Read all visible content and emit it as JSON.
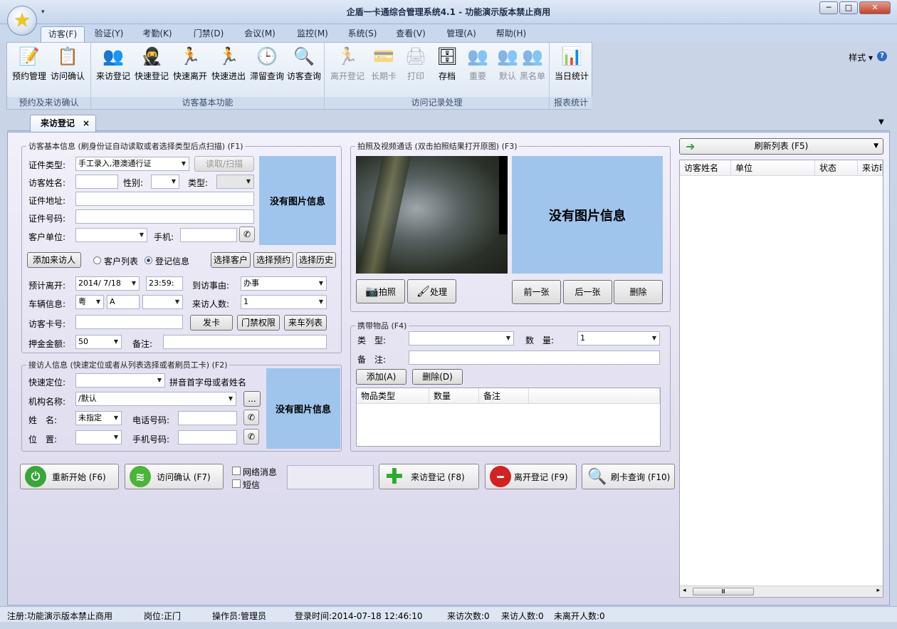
{
  "window": {
    "title": "企盾一卡通综合管理系统4.1 - 功能演示版本禁止商用",
    "qat": "▾"
  },
  "ribbon_tabs": [
    "访客(F)",
    "验证(Y)",
    "考勤(K)",
    "门禁(D)",
    "会议(M)",
    "监控(M)",
    "系统(S)",
    "查看(V)",
    "管理(A)",
    "帮助(H)"
  ],
  "style_menu": "样式",
  "ribbon": {
    "groups": [
      {
        "label": "预约及来访确认",
        "buttons": [
          {
            "label": "预约管理",
            "icon": "calendar-edit-icon"
          },
          {
            "label": "访问确认",
            "icon": "checklist-icon"
          }
        ]
      },
      {
        "label": "访客基本功能",
        "buttons": [
          {
            "label": "来访登记",
            "icon": "visitors-icon"
          },
          {
            "label": "快速登记",
            "icon": "ninja-icon"
          },
          {
            "label": "快速离开",
            "icon": "runner-icon"
          },
          {
            "label": "快速进出",
            "icon": "runner-icon"
          },
          {
            "label": "滞留查询",
            "icon": "person-clock-icon"
          },
          {
            "label": "访客查询",
            "icon": "person-search-icon"
          }
        ]
      },
      {
        "label": "访问记录处理",
        "buttons": [
          {
            "label": "离开登记",
            "icon": "runner-icon",
            "disabled": true
          },
          {
            "label": "长期卡",
            "icon": "card-icon",
            "disabled": true
          },
          {
            "label": "打印",
            "icon": "printer-icon",
            "disabled": true
          },
          {
            "label": "存档",
            "icon": "archive-icon"
          },
          {
            "label": "重要",
            "icon": "users-check-icon",
            "disabled": true
          },
          {
            "label": "默认",
            "icon": "users-icon",
            "disabled": true
          },
          {
            "label": "黑名单",
            "icon": "users-block-icon",
            "disabled": true
          }
        ]
      },
      {
        "label": "报表统计",
        "buttons": [
          {
            "label": "当日统计",
            "icon": "bar-chart-icon"
          }
        ]
      }
    ]
  },
  "doc_tab": {
    "label": "来访登记",
    "close": "×"
  },
  "visitor_info": {
    "legend": "访客基本信息 (刷身份证自动读取或者选择类型后点扫描) (F1)",
    "id_type_label": "证件类型:",
    "id_type_value": "手工录入,港澳通行证",
    "read_scan": "读取/扫描",
    "name_label": "访客姓名:",
    "gender_label": "性别:",
    "type_label": "类型:",
    "address_label": "证件地址:",
    "id_no_label": "证件号码:",
    "company_label": "客户单位:",
    "mobile_label": "手机:",
    "no_image": "没有图片信息",
    "add_visitor": "添加来访人",
    "radio_customer": "客户列表",
    "radio_register": "登记信息",
    "select_customer": "选择客户",
    "select_reservation": "选择预约",
    "select_history": "选择历史",
    "leave_label": "预计离开:",
    "leave_date": "2014/ 7/18",
    "leave_time": "23:59:",
    "reason_label": "到访事由:",
    "reason_value": "办事",
    "vehicle_label": "车辆信息:",
    "vehicle_prov": "粤",
    "vehicle_letter": "A",
    "count_label": "来访人数:",
    "count_value": "1",
    "card_label": "访客卡号:",
    "issue_card": "发卡",
    "door_rights": "门禁权限",
    "car_list": "来车列表",
    "deposit_label": "押金金额:",
    "deposit_value": "50",
    "remark_label": "备注:"
  },
  "host_info": {
    "legend": "接访人信息 (快速定位或者从列表选择或者刷员工卡) (F2)",
    "quick_label": "快速定位:",
    "quick_hint": "拼音首字母或者姓名",
    "org_label": "机构名称:",
    "org_value": "/默认",
    "org_more": "...",
    "name_label": "姓　名:",
    "name_value": "未指定",
    "phone_label": "电话号码:",
    "position_label": "位　置:",
    "mobile_label": "手机号码:",
    "no_image": "没有图片信息"
  },
  "photo": {
    "legend": "拍照及视频通话 (双击拍照结果打开原图) (F3)",
    "no_image": "没有图片信息",
    "take_photo": "拍照",
    "process": "处理",
    "prev": "前一张",
    "next": "后一张",
    "delete": "删除"
  },
  "items": {
    "legend": "携带物品 (F4)",
    "type_label": "类　型:",
    "qty_label": "数　量:",
    "qty_value": "1",
    "remark_label": "备　注:",
    "add": "添加(A)",
    "delete": "删除(D)",
    "columns": [
      "物品类型",
      "数量",
      "备注"
    ]
  },
  "actions": {
    "restart": "重新开始 (F6)",
    "confirm": "访问确认 (F7)",
    "net_msg": "网络消息",
    "sms": "短信",
    "register": "来访登记 (F8)",
    "leave": "离开登记 (F9)",
    "swipe_query": "刷卡查询 (F10)"
  },
  "visitor_list": {
    "refresh": "刷新列表 (F5)",
    "columns": [
      "访客姓名",
      "单位",
      "状态",
      "来访时"
    ],
    "scroll_mark": "Ⅲ"
  },
  "status": {
    "register": "注册:功能演示版本禁止商用",
    "post": "岗位:正门",
    "operator": "操作员:管理员",
    "login_time": "登录时间:2014-07-18 12:46:10",
    "visits": "来访次数:0",
    "visitors": "来访人数:0",
    "not_left": "未离开人数:0"
  },
  "colors": {
    "accent": "#9fc5ec",
    "ribbon_bg": "#dbe6f3",
    "form_bg": "#e6e4f2"
  }
}
